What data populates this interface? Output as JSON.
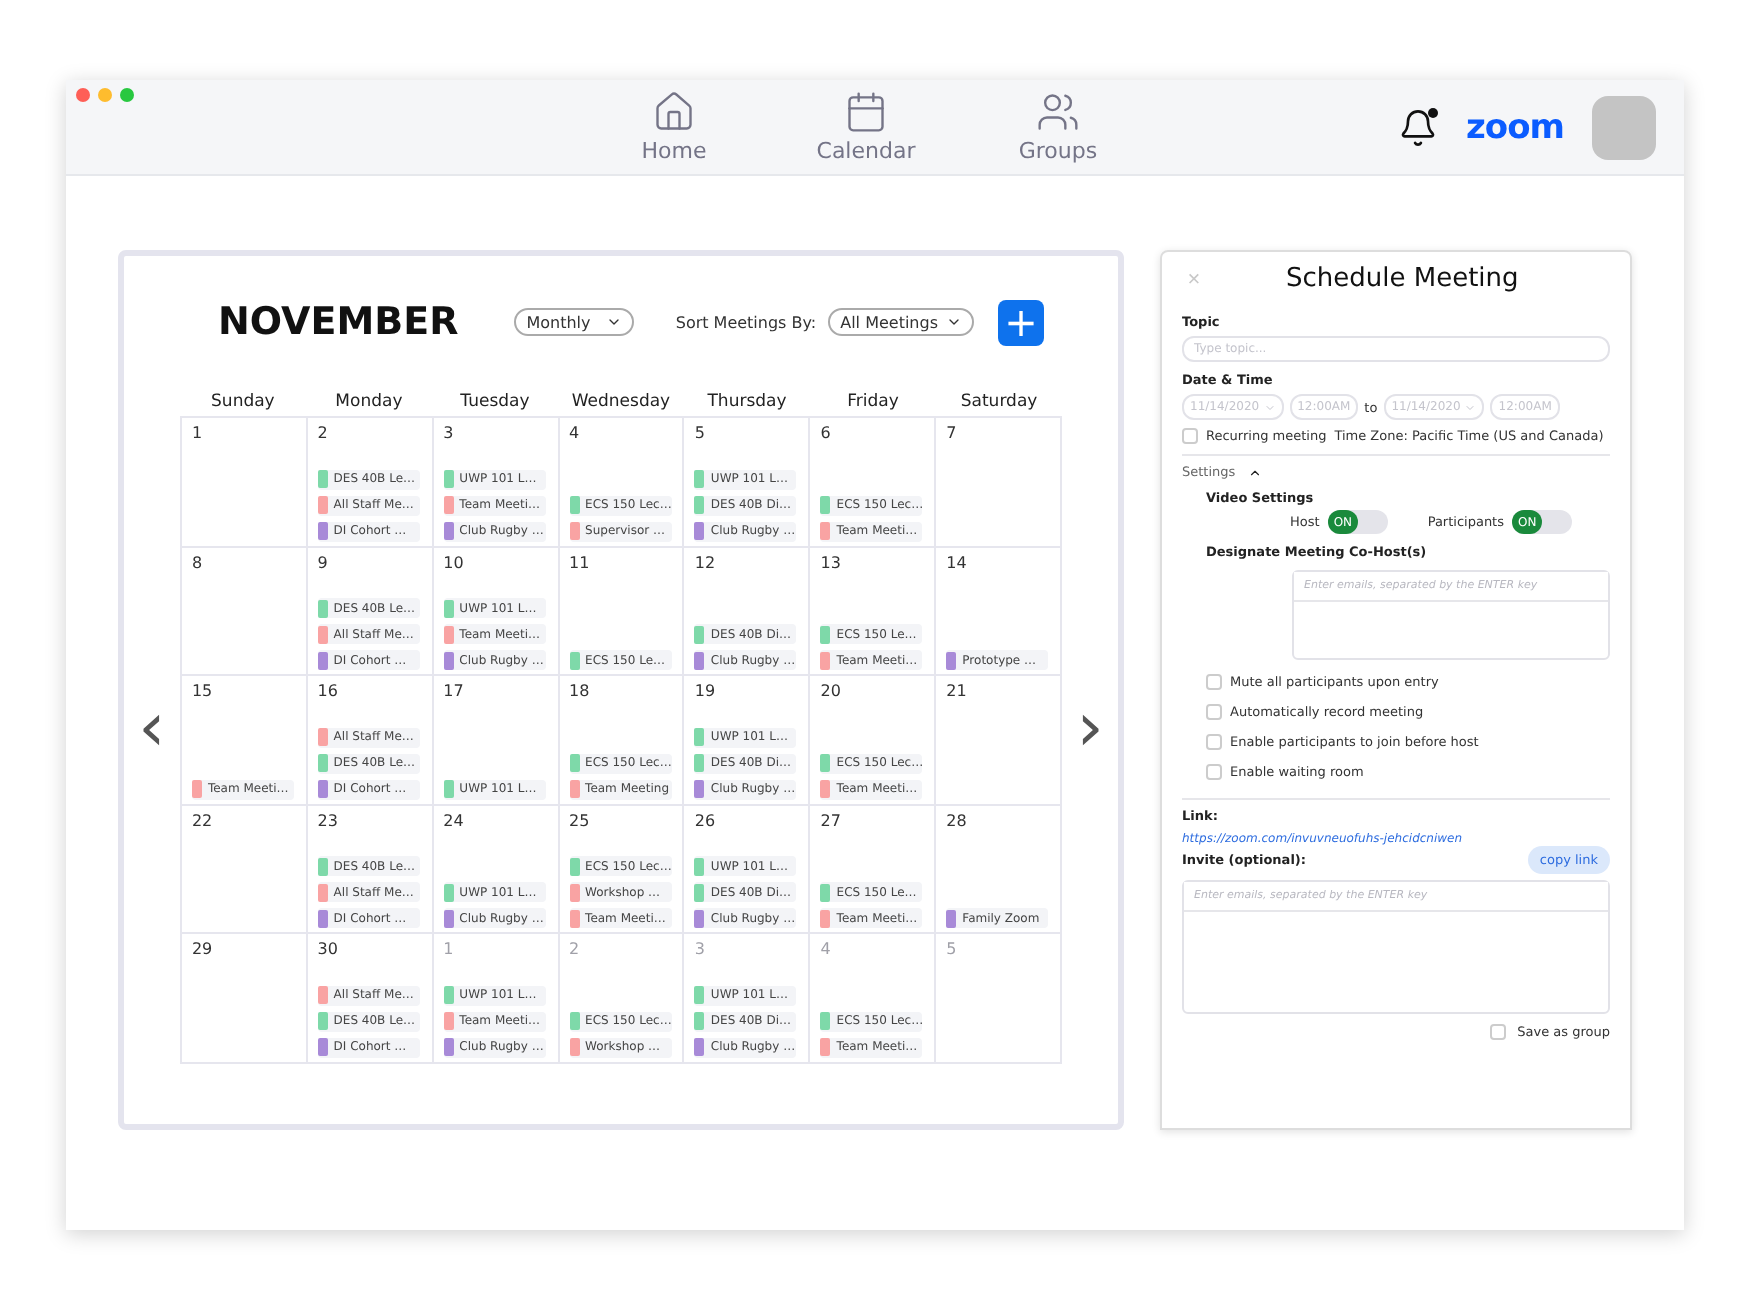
{
  "window": {
    "nav": [
      {
        "label": "Home",
        "kind": "home",
        "selected": false
      },
      {
        "label": "Calendar",
        "kind": "calendar",
        "selected": false
      },
      {
        "label": "Groups",
        "kind": "groups",
        "selected": false
      }
    ],
    "notifications": {
      "unread": true
    },
    "brand": "zoom"
  },
  "calendar": {
    "month": "NOVEMBER",
    "view": "Monthly",
    "sort_label": "Sort Meetings By:",
    "sort_value": "All Meetings",
    "add_button": "+",
    "prev": "‹",
    "next": "›",
    "weekdays": [
      "Sunday",
      "Monday",
      "Tuesday",
      "Wednesday",
      "Thursday",
      "Friday",
      "Saturday"
    ],
    "weeks": [
      [
        {
          "number": "1",
          "muted": false
        },
        {
          "number": "2",
          "muted": false,
          "events": [
            {
              "title": "DES 40B Le…",
              "color": "#7ed9a9"
            },
            {
              "title": "All Staff Me…",
              "color": "#f9a3a3"
            },
            {
              "title": "DI Cohort …",
              "color": "#a88ad8"
            }
          ]
        },
        {
          "number": "3",
          "muted": false,
          "events": [
            {
              "title": "UWP 101 L…",
              "color": "#7ed9a9"
            },
            {
              "title": "Team Meeti…",
              "color": "#f9a3a3"
            },
            {
              "title": "Club Rugby …",
              "color": "#a88ad8"
            }
          ]
        },
        {
          "number": "4",
          "muted": false,
          "events": [
            {
              "title": "ECS 150 Lec…",
              "color": "#7ed9a9"
            },
            {
              "title": "Supervisor …",
              "color": "#f9a3a3"
            }
          ]
        },
        {
          "number": "5",
          "muted": false,
          "events": [
            {
              "title": "UWP 101 L…",
              "color": "#7ed9a9"
            },
            {
              "title": "DES 40B Di…",
              "color": "#7ed9a9"
            },
            {
              "title": "Club Rugby …",
              "color": "#a88ad8"
            }
          ]
        },
        {
          "number": "6",
          "muted": false,
          "events": [
            {
              "title": "ECS 150 Lec…",
              "color": "#7ed9a9"
            },
            {
              "title": "Team Meeti…",
              "color": "#f9a3a3"
            }
          ]
        },
        {
          "number": "7",
          "muted": false
        }
      ],
      [
        {
          "number": "8",
          "muted": false
        },
        {
          "number": "9",
          "muted": false,
          "events": [
            {
              "title": "DES 40B Le…",
              "color": "#7ed9a9"
            },
            {
              "title": "All Staff Me…",
              "color": "#f9a3a3"
            },
            {
              "title": "DI Cohort …",
              "color": "#a88ad8"
            }
          ]
        },
        {
          "number": "10",
          "muted": false,
          "events": [
            {
              "title": "UWP 101 L…",
              "color": "#7ed9a9"
            },
            {
              "title": "Team Meeti…",
              "color": "#f9a3a3"
            },
            {
              "title": "Club Rugby …",
              "color": "#a88ad8"
            }
          ]
        },
        {
          "number": "11",
          "muted": false,
          "events": [
            {
              "title": "ECS 150 Le…",
              "color": "#7ed9a9"
            }
          ]
        },
        {
          "number": "12",
          "muted": false,
          "events": [
            {
              "title": "DES 40B Di…",
              "color": "#7ed9a9"
            },
            {
              "title": "Club Rugby …",
              "color": "#a88ad8"
            }
          ]
        },
        {
          "number": "13",
          "muted": false,
          "events": [
            {
              "title": "ECS 150 Le…",
              "color": "#7ed9a9"
            },
            {
              "title": "Team Meeti…",
              "color": "#f9a3a3"
            }
          ]
        },
        {
          "number": "14",
          "muted": false,
          "events": [
            {
              "title": "Prototype …",
              "color": "#a88ad8"
            }
          ]
        }
      ],
      [
        {
          "number": "15",
          "muted": false,
          "events": [
            {
              "title": "Team Meeti…",
              "color": "#f9a3a3"
            }
          ]
        },
        {
          "number": "16",
          "muted": false,
          "events": [
            {
              "title": "All Staff Me…",
              "color": "#f9a3a3"
            },
            {
              "title": "DES 40B Le…",
              "color": "#7ed9a9"
            },
            {
              "title": "DI Cohort …",
              "color": "#a88ad8"
            }
          ]
        },
        {
          "number": "17",
          "muted": false,
          "events": [
            {
              "title": "UWP 101 L…",
              "color": "#7ed9a9"
            }
          ]
        },
        {
          "number": "18",
          "muted": false,
          "events": [
            {
              "title": "ECS 150 Lec…",
              "color": "#7ed9a9"
            },
            {
              "title": "Team Meeting",
              "color": "#f9a3a3"
            }
          ]
        },
        {
          "number": "19",
          "muted": false,
          "events": [
            {
              "title": "UWP 101 L…",
              "color": "#7ed9a9"
            },
            {
              "title": "DES 40B Di…",
              "color": "#7ed9a9"
            },
            {
              "title": "Club Rugby …",
              "color": "#a88ad8"
            }
          ]
        },
        {
          "number": "20",
          "muted": false,
          "events": [
            {
              "title": "ECS 150 Lec…",
              "color": "#7ed9a9"
            },
            {
              "title": "Team Meeti…",
              "color": "#f9a3a3"
            }
          ]
        },
        {
          "number": "21",
          "muted": false
        }
      ],
      [
        {
          "number": "22",
          "muted": false
        },
        {
          "number": "23",
          "muted": false,
          "events": [
            {
              "title": "DES 40B Le…",
              "color": "#7ed9a9"
            },
            {
              "title": "All Staff Me…",
              "color": "#f9a3a3"
            },
            {
              "title": "DI Cohort …",
              "color": "#a88ad8"
            }
          ]
        },
        {
          "number": "24",
          "muted": false,
          "events": [
            {
              "title": "UWP 101 L…",
              "color": "#7ed9a9"
            },
            {
              "title": "Club Rugby …",
              "color": "#a88ad8"
            }
          ]
        },
        {
          "number": "25",
          "muted": false,
          "events": [
            {
              "title": "ECS 150 Lec…",
              "color": "#7ed9a9"
            },
            {
              "title": "Workshop …",
              "color": "#f9a3a3"
            },
            {
              "title": "Team Meeti…",
              "color": "#f9a3a3"
            }
          ]
        },
        {
          "number": "26",
          "muted": false,
          "events": [
            {
              "title": "UWP 101 L…",
              "color": "#7ed9a9"
            },
            {
              "title": "DES 40B Di…",
              "color": "#7ed9a9"
            },
            {
              "title": "Club Rugby …",
              "color": "#a88ad8"
            }
          ]
        },
        {
          "number": "27",
          "muted": false,
          "events": [
            {
              "title": "ECS 150 Le…",
              "color": "#7ed9a9"
            },
            {
              "title": "Team Meeti…",
              "color": "#f9a3a3"
            }
          ]
        },
        {
          "number": "28",
          "muted": false,
          "events": [
            {
              "title": "Family Zoom",
              "color": "#a88ad8"
            }
          ]
        }
      ],
      [
        {
          "number": "29",
          "muted": false
        },
        {
          "number": "30",
          "muted": false,
          "events": [
            {
              "title": "All Staff Me…",
              "color": "#f9a3a3"
            },
            {
              "title": "DES 40B Le…",
              "color": "#7ed9a9"
            },
            {
              "title": "DI Cohort …",
              "color": "#a88ad8"
            }
          ]
        },
        {
          "number": "1",
          "muted": true,
          "events": [
            {
              "title": "UWP 101 L…",
              "color": "#7ed9a9"
            },
            {
              "title": "Team Meeti…",
              "color": "#f9a3a3"
            },
            {
              "title": "Club Rugby …",
              "color": "#a88ad8"
            }
          ]
        },
        {
          "number": "2",
          "muted": true,
          "events": [
            {
              "title": "ECS 150 Lec…",
              "color": "#7ed9a9"
            },
            {
              "title": "Workshop …",
              "color": "#f9a3a3"
            }
          ]
        },
        {
          "number": "3",
          "muted": true,
          "events": [
            {
              "title": "UWP 101 L…",
              "color": "#7ed9a9"
            },
            {
              "title": "DES 40B Di…",
              "color": "#7ed9a9"
            },
            {
              "title": "Club Rugby …",
              "color": "#a88ad8"
            }
          ]
        },
        {
          "number": "4",
          "muted": true,
          "events": [
            {
              "title": "ECS 150 Lec…",
              "color": "#7ed9a9"
            },
            {
              "title": "Team Meeti…",
              "color": "#f9a3a3"
            }
          ]
        },
        {
          "number": "5",
          "muted": true
        }
      ]
    ]
  },
  "schedule": {
    "close": "×",
    "title": "Schedule Meeting",
    "topic_label": "Topic",
    "topic_placeholder": "Type topic...",
    "datetime_label": "Date & Time",
    "start_date": "11/14/2020",
    "start_time": "12:00AM",
    "to": "to",
    "end_date": "11/14/2020",
    "end_time": "12:00AM",
    "recurring": {
      "label": "Recurring meeting",
      "checked": false
    },
    "time_zone": "Time Zone: Pacific Time (US and Canada)",
    "settings": {
      "label": "Settings",
      "expanded": true
    },
    "video_label": "Video Settings",
    "toggles": [
      {
        "label": "Host",
        "on": true,
        "state_text": "ON"
      },
      {
        "label": "Participants",
        "on": true,
        "state_text": "ON"
      }
    ],
    "cohost_label": "Designate Meeting Co-Host(s)",
    "cohost_placeholder": "Enter emails, separated by the ENTER key",
    "options": [
      {
        "label": "Mute all participants upon entry",
        "checked": false
      },
      {
        "label": "Automatically record meeting",
        "checked": false
      },
      {
        "label": "Enable participants to join before host",
        "checked": false
      },
      {
        "label": "Enable waiting room",
        "checked": false
      }
    ],
    "link_label": "Link:",
    "link": "https://zoom.com/invuvneuofuhs-jehcidcniwen",
    "copy_button": "copy link",
    "invite_label": "Invite (optional):",
    "invite_placeholder": "Enter emails, separated by the ENTER key",
    "save_group": {
      "label": "Save as group",
      "checked": false
    }
  }
}
